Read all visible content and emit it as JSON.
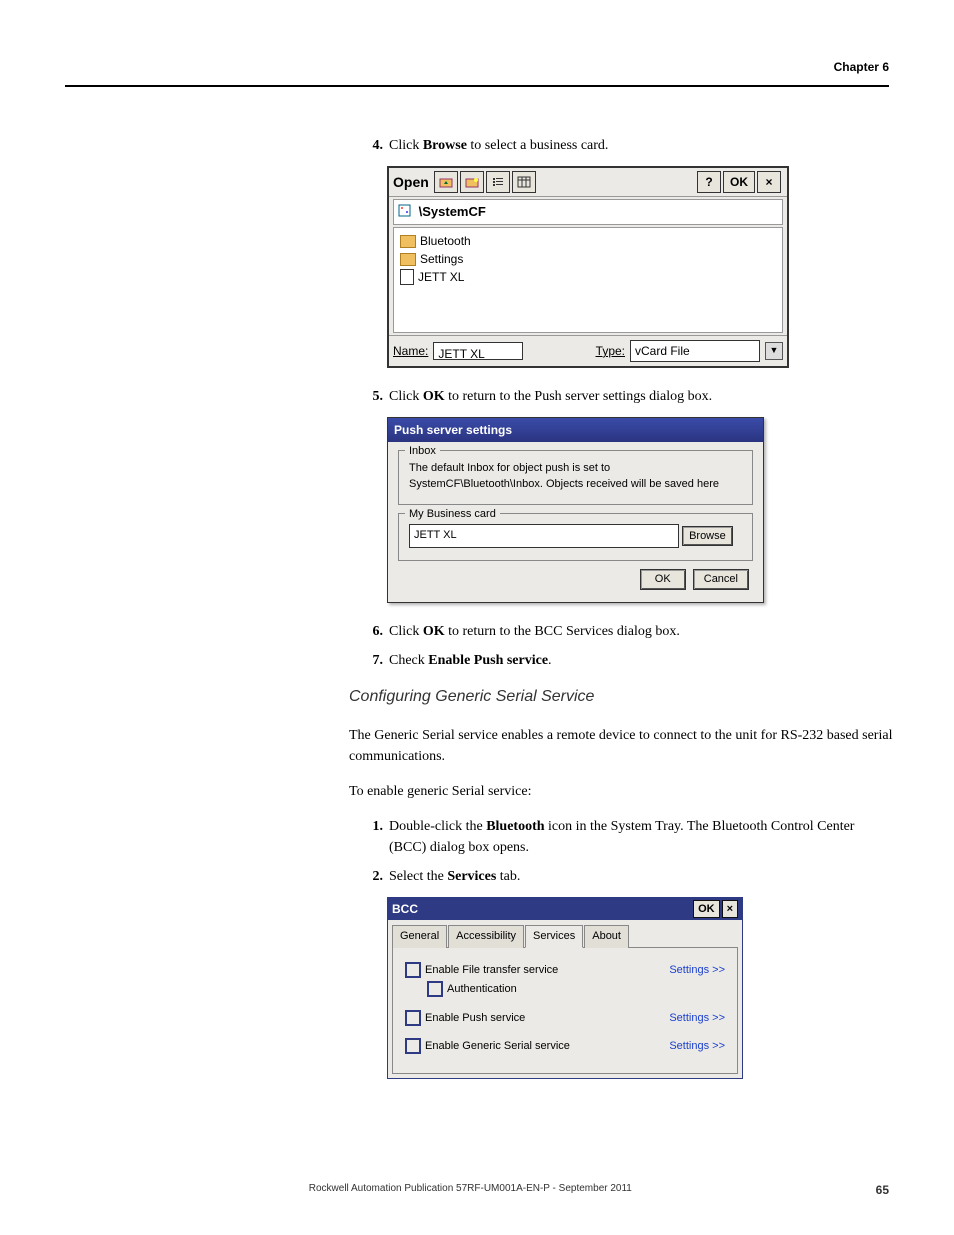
{
  "header": {
    "chapter": "Chapter 6"
  },
  "steps": {
    "s4": {
      "num": "4.",
      "text_a": "Click ",
      "bold": "Browse",
      "text_b": " to select a business card."
    },
    "s5": {
      "num": "5.",
      "text_a": "Click ",
      "bold": "OK",
      "text_b": " to return to the Push server settings dialog box."
    },
    "s6": {
      "num": "6.",
      "text_a": "Click ",
      "bold": "OK",
      "text_b": " to return to the BCC Services dialog box."
    },
    "s7": {
      "num": "7.",
      "text_a": "Check ",
      "bold": "Enable Push service",
      "text_b": "."
    }
  },
  "open_dialog": {
    "title": "Open",
    "help": "?",
    "ok": "OK",
    "close": "×",
    "location": "\\SystemCF",
    "files": [
      "Bluetooth",
      "Settings",
      "JETT XL"
    ],
    "name_label": "Name:",
    "name_value": "JETT XL",
    "type_label": "Type:",
    "type_value": "vCard File"
  },
  "push_dialog": {
    "title": "Push server settings",
    "inbox_legend": "Inbox",
    "inbox_text": "The default Inbox for object push is set to SystemCF\\Bluetooth\\Inbox. Objects received will be saved here",
    "bc_legend": "My Business card",
    "bc_value": "JETT XL",
    "browse": "Browse",
    "ok": "OK",
    "cancel": "Cancel"
  },
  "section": {
    "subheading": "Configuring Generic Serial Service",
    "intro": "The Generic Serial service enables a remote device to connect to the unit for RS-232 based serial communications.",
    "lead": "To enable generic Serial service:",
    "s1": {
      "num": "1.",
      "a": "Double-click the ",
      "b": "Bluetooth",
      "c": " icon in the System Tray. The Bluetooth Control Center (BCC) dialog box opens."
    },
    "s2": {
      "num": "2.",
      "a": "Select the ",
      "b": "Services",
      "c": " tab."
    }
  },
  "bcc": {
    "title": "BCC",
    "ok": "OK",
    "close": "×",
    "tabs": {
      "general": "General",
      "accessibility": "Accessibility",
      "services": "Services",
      "about": "About"
    },
    "svc1": "Enable File transfer service",
    "svc1sub": "Authentication",
    "svc2": "Enable Push service",
    "svc3": "Enable Generic Serial service",
    "settings": "Settings >>"
  },
  "footer": {
    "center": "Rockwell Automation Publication 57RF-UM001A-EN-P - September 2011",
    "page": "65"
  }
}
